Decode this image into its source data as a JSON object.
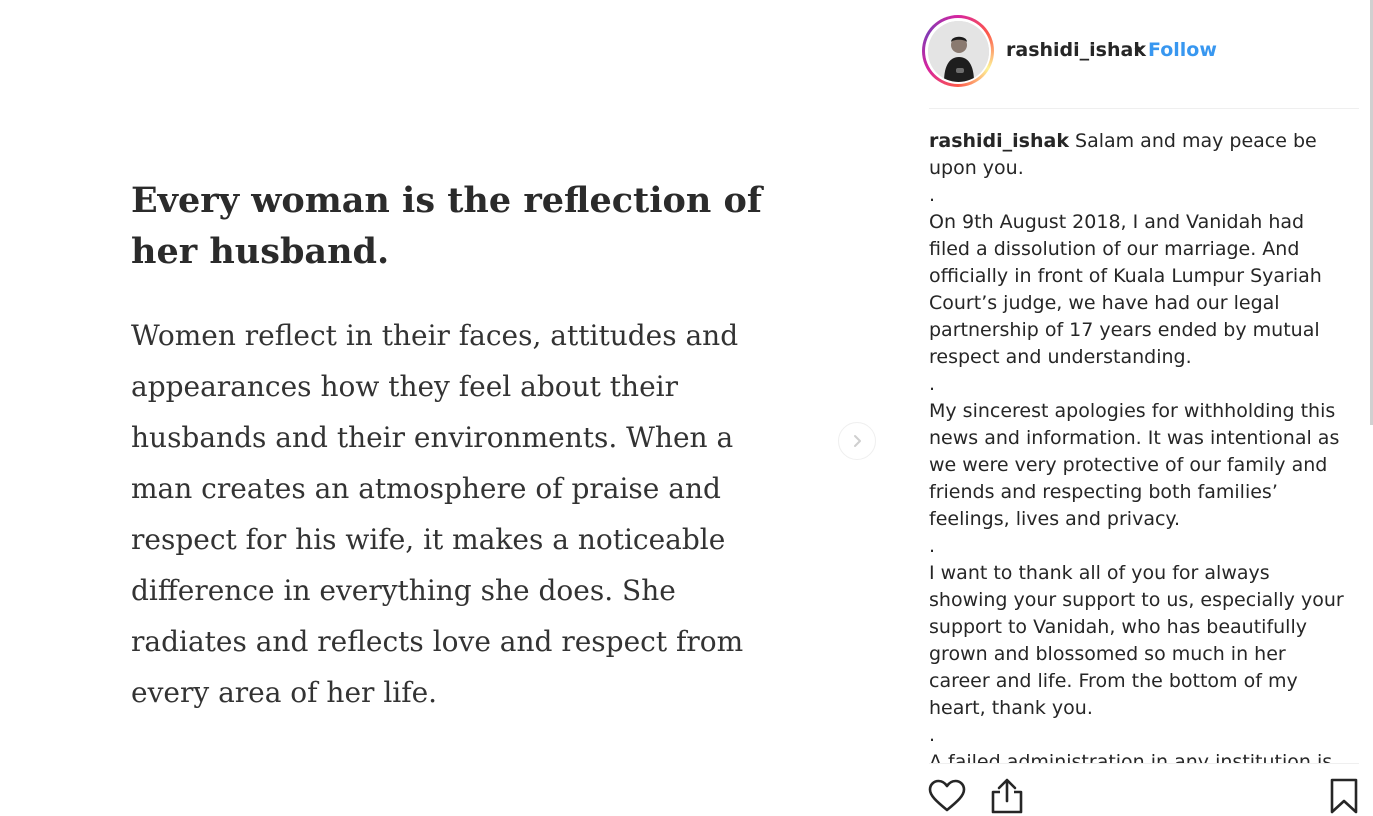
{
  "post": {
    "image_text": {
      "heading_lines": [
        "Every woman is the reflection of",
        "her husband."
      ],
      "body_lines": [
        "Women reflect in their faces, attitudes and",
        "appearances how they feel about their",
        "husbands and their environments. When a",
        "man creates an atmosphere of praise and",
        "respect for his wife, it makes a noticeable",
        "difference in everything she does. She",
        "radiates and reflects love and respect from",
        "every area of her life."
      ]
    },
    "next_icon": "chevron-right-icon"
  },
  "header": {
    "username": "rashidi_ishak",
    "separator": "•",
    "follow_label": "Follow",
    "avatar_icon": "profile-photo"
  },
  "caption": {
    "username": "rashidi_ishak",
    "first_line_text": " Salam and may peace be",
    "lines": [
      "upon you.",
      ".",
      "On 9th August 2018, I and Vanidah had",
      "filed a dissolution of our marriage. And",
      "officially in front of Kuala Lumpur Syariah",
      "Court’s judge, we have had our legal",
      "partnership of 17 years ended by mutual",
      "respect and understanding.",
      ".",
      "My sincerest apologies for withholding this",
      "news and information. It was intentional as",
      "we were very protective of our family and",
      "friends and respecting both families’",
      "feelings, lives and privacy.",
      ".",
      "I want to thank all of you for always",
      "showing your support to us, especially your",
      "support to Vanidah, who has beautifully",
      "grown and blossomed so much in her",
      "career and life. From the bottom of my",
      "heart, thank you.",
      ".",
      "A failed administration in any institution is"
    ]
  },
  "actions": {
    "like_icon": "heart-icon",
    "share_icon": "share-icon",
    "save_icon": "bookmark-icon"
  },
  "colors": {
    "link_blue": "#3897f0",
    "text": "#262626",
    "divider": "#efefef"
  }
}
